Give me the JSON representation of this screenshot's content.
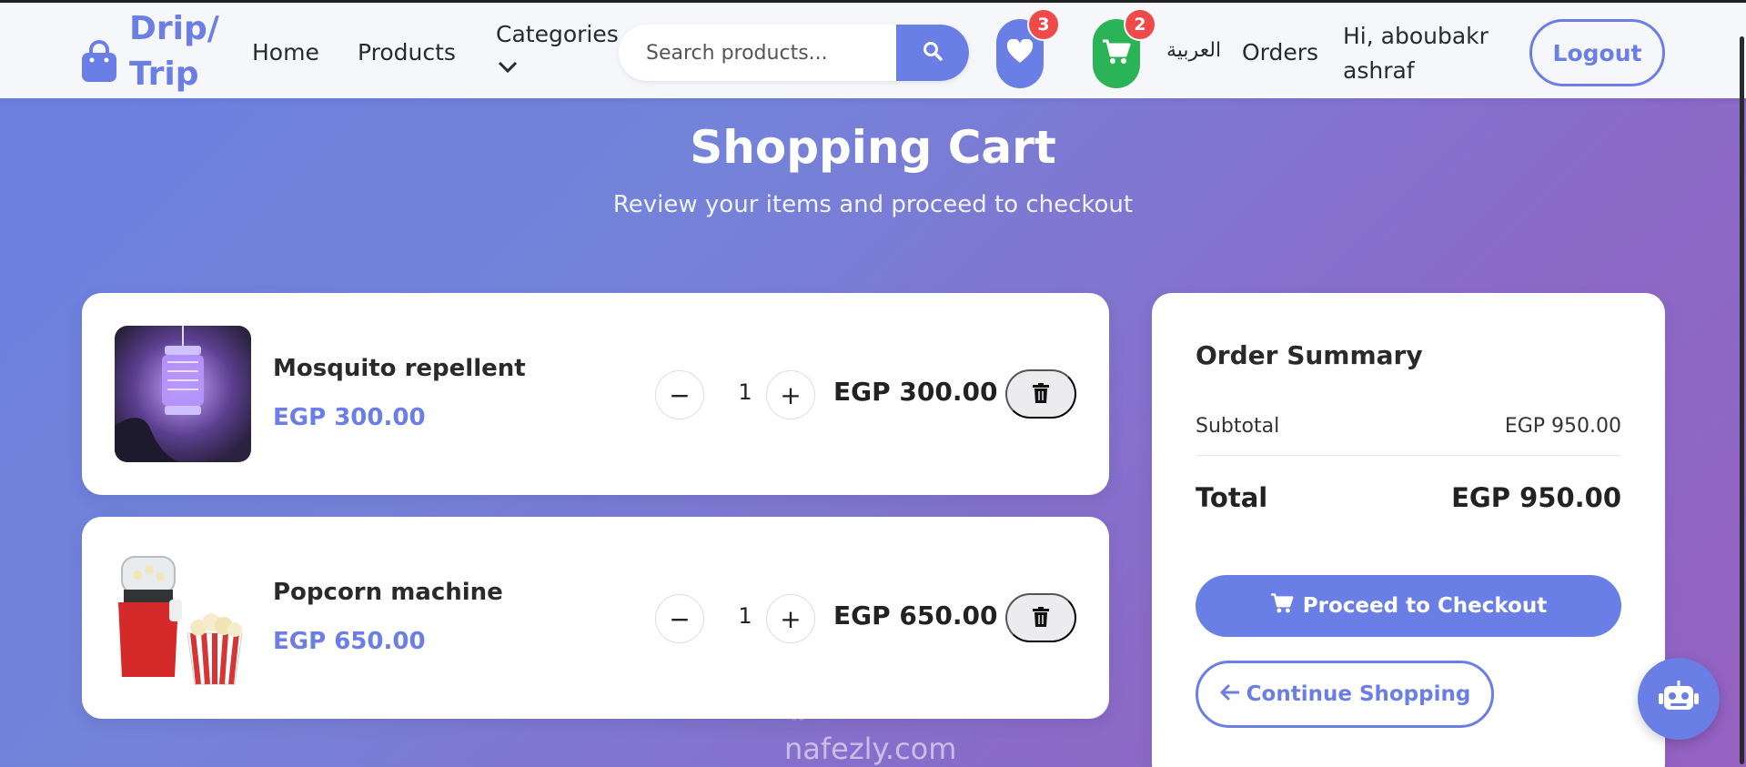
{
  "header": {
    "logo_line1": "Drip/",
    "logo_line2": "Trip",
    "nav": {
      "home": "Home",
      "products": "Products",
      "categories": "Categories",
      "orders": "Orders"
    },
    "search_placeholder": "Search products...",
    "wishlist_count": "3",
    "cart_count": "2",
    "language": "العربية",
    "greeting": "Hi, aboubakr ashraf",
    "logout": "Logout"
  },
  "hero": {
    "title": "Shopping Cart",
    "subtitle": "Review your items and proceed to checkout"
  },
  "cart": {
    "items": [
      {
        "name": "Mosquito repellent",
        "price": "EGP 300.00",
        "quantity": "1",
        "line_total": "EGP 300.00"
      },
      {
        "name": "Popcorn machine",
        "price": "EGP 650.00",
        "quantity": "1",
        "line_total": "EGP 650.00"
      }
    ],
    "minus_symbol": "−",
    "plus_symbol": "+"
  },
  "summary": {
    "title": "Order Summary",
    "subtotal_label": "Subtotal",
    "subtotal_value": "EGP 950.00",
    "total_label": "Total",
    "total_value": "EGP 950.00",
    "checkout_label": "Proceed to Checkout",
    "continue_label": "Continue Shopping"
  },
  "watermark": {
    "arabic": "نفذلي",
    "latin": "nafezly.com"
  },
  "colors": {
    "accent": "#6b7ee6",
    "cart_pill": "#2bb457",
    "badge": "#ef4a4a",
    "gradient_start": "#6a7fe0",
    "gradient_end": "#9561c2"
  },
  "icons": {
    "logo": "shopping-bag-icon",
    "search": "search-icon",
    "wishlist": "heart-icon",
    "cart": "shopping-cart-icon",
    "delete": "trash-icon",
    "checkout": "cart-icon",
    "continue": "arrow-left-icon",
    "chatbot": "robot-icon",
    "categories": "chevron-down-icon"
  }
}
